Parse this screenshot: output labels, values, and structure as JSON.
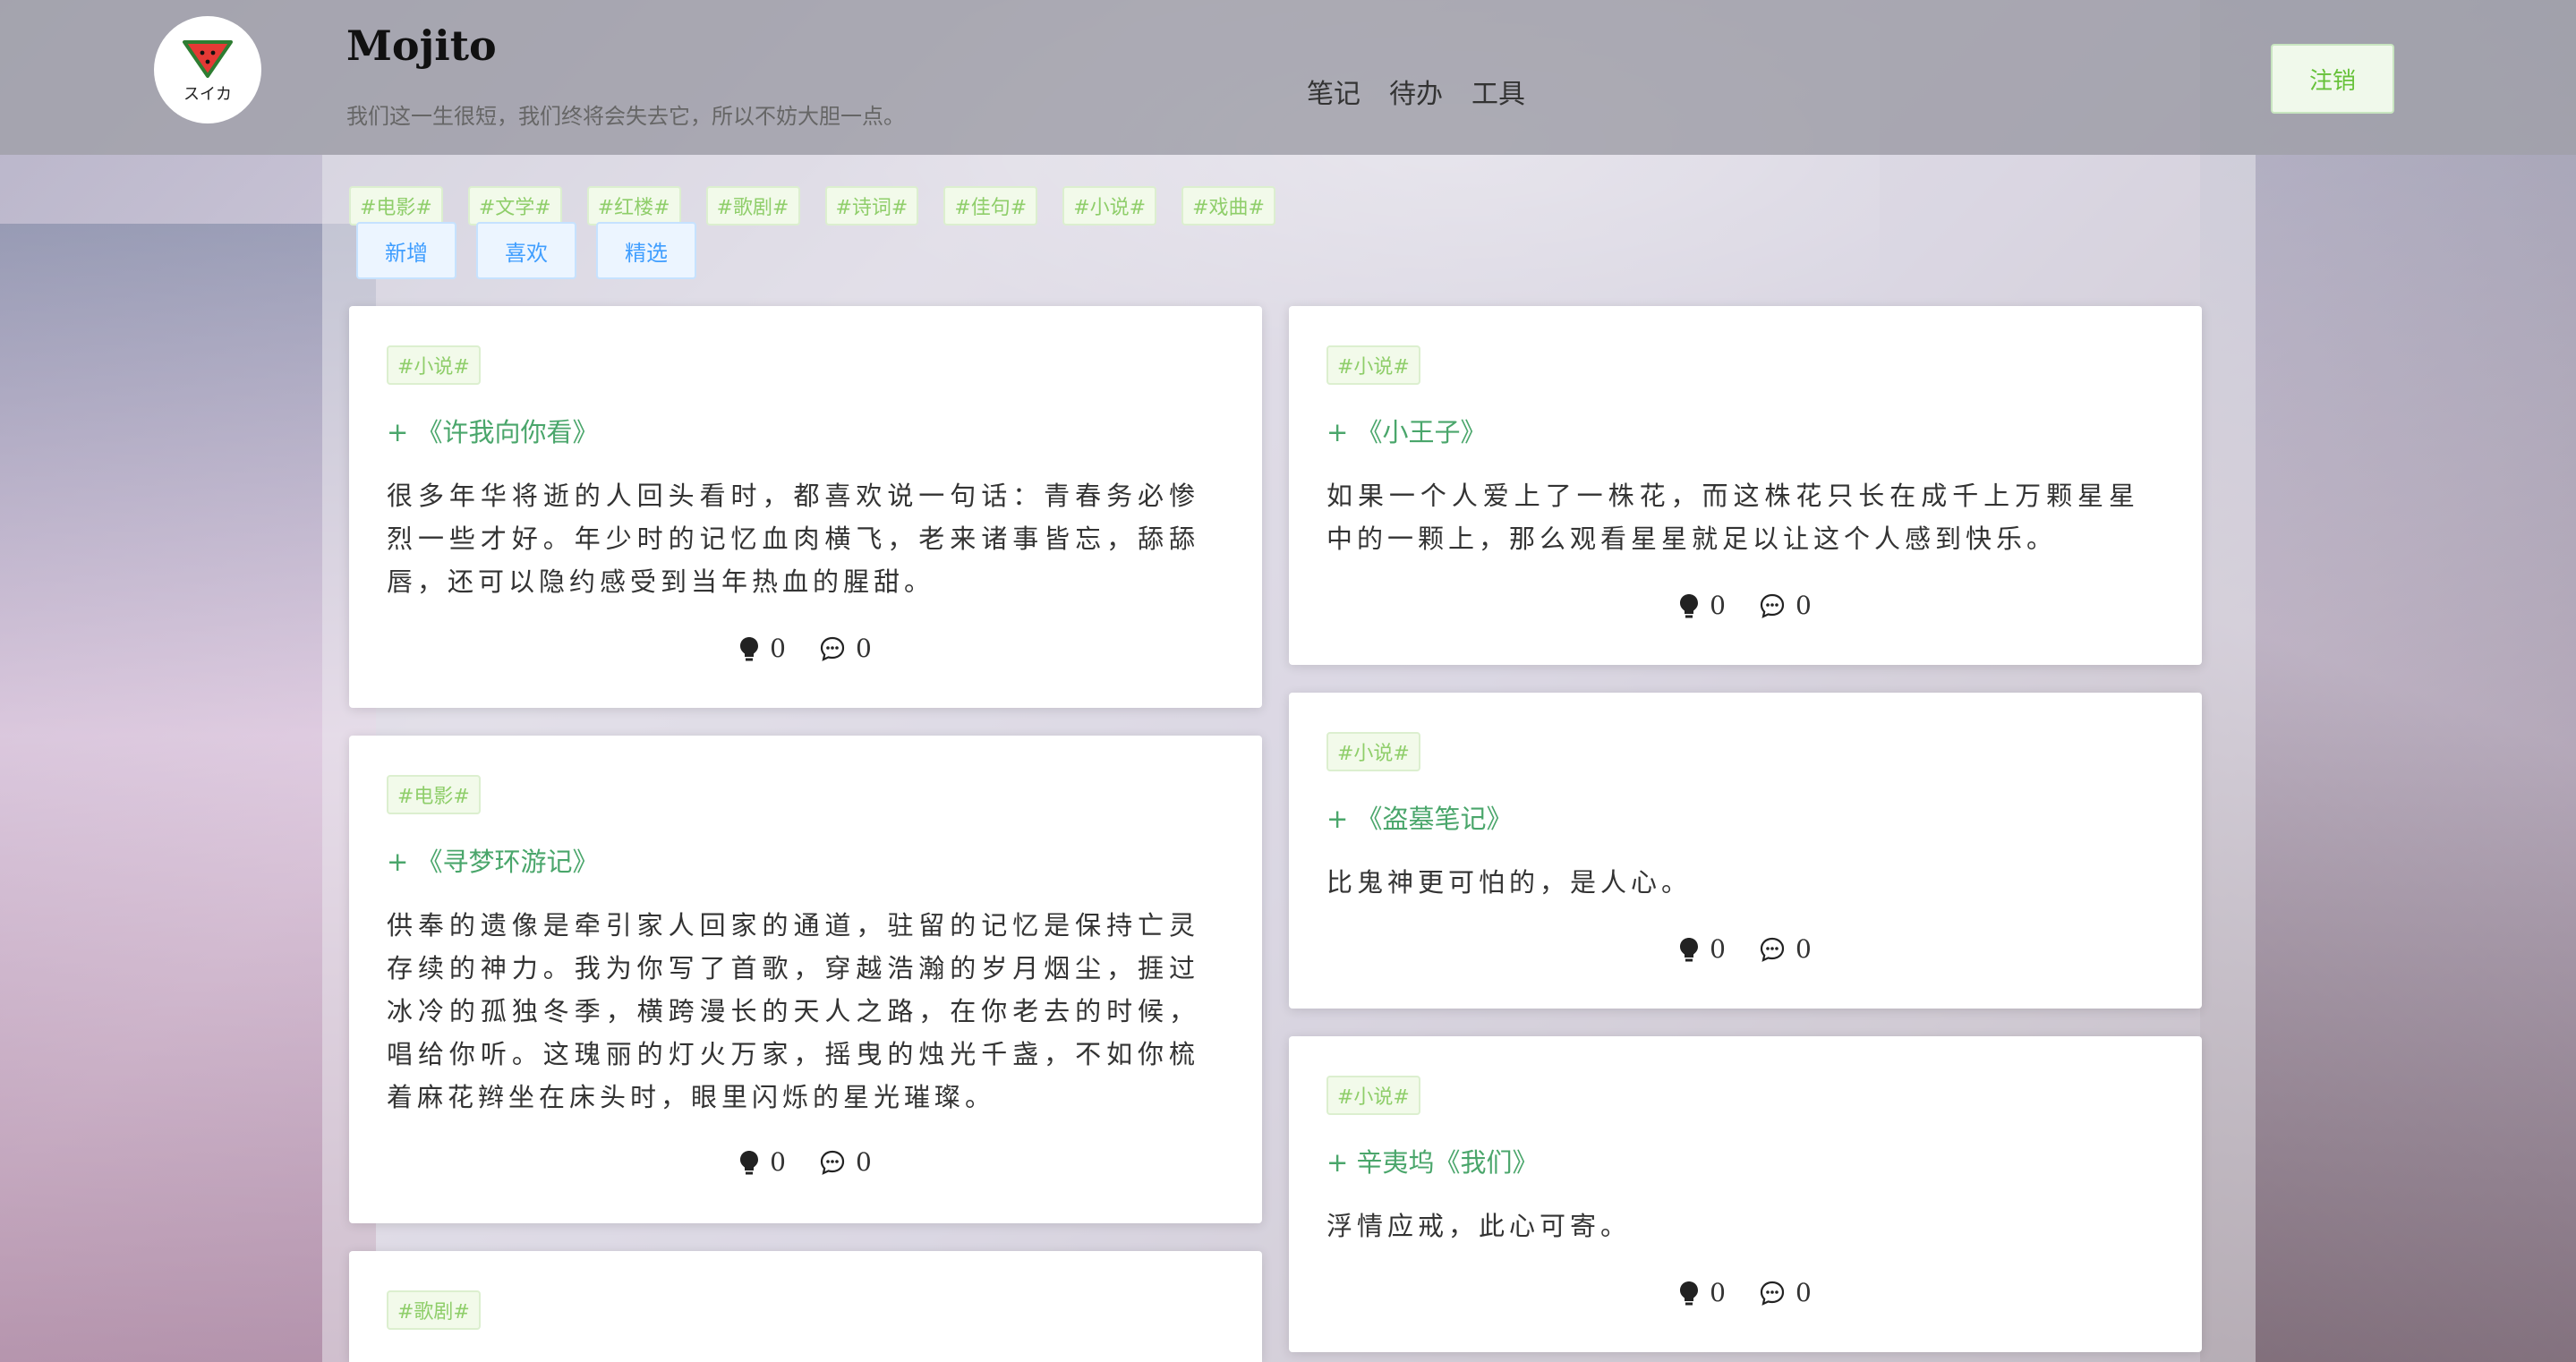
{
  "header": {
    "logo_text": "スイカ",
    "title": "Mojito",
    "motto": "我们这一生很短，我们终将会失去它，所以不妨大胆一点。",
    "nav": [
      "笔记",
      "待办",
      "工具"
    ],
    "logout_label": "注销"
  },
  "tags": [
    "#电影#",
    "#文学#",
    "#红楼#",
    "#歌剧#",
    "#诗词#",
    "#佳句#",
    "#小说#",
    "#戏曲#"
  ],
  "actions": [
    "新增",
    "喜欢",
    "精选"
  ],
  "cards": [
    {
      "tag": "#小说#",
      "title": "+ 《许我向你看》",
      "content": "很多年华将逝的人回头看时，都喜欢说一句话：青春务必惨烈一些才好。年少时的记忆血肉横飞，老来诸事皆忘，舔舔唇，还可以隐约感受到当年热血的腥甜。",
      "likes": "0",
      "comments": "0"
    },
    {
      "tag": "#电影#",
      "title": "+ 《寻梦环游记》",
      "content": "供奉的遗像是牵引家人回家的通道，驻留的记忆是保持亡灵存续的神力。我为你写了首歌，穿越浩瀚的岁月烟尘，捱过冰冷的孤独冬季，横跨漫长的天人之路，在你老去的时候，唱给你听。这瑰丽的灯火万家，摇曳的烛光千盏，不如你梳着麻花辫坐在床头时，眼里闪烁的星光璀璨。",
      "likes": "0",
      "comments": "0"
    },
    {
      "tag": "#歌剧#"
    },
    {
      "tag": "#小说#",
      "title": "+ 《小王子》",
      "content": "如果一个人爱上了一株花，而这株花只长在成千上万颗星星中的一颗上，那么观看星星就足以让这个人感到快乐。",
      "likes": "0",
      "comments": "0"
    },
    {
      "tag": "#小说#",
      "title": "+ 《盗墓笔记》",
      "content": "比鬼神更可怕的，是人心。",
      "likes": "0",
      "comments": "0"
    },
    {
      "tag": "#小说#",
      "title": "+ 辛夷坞《我们》",
      "content": "浮情应戒，此心可寄。",
      "likes": "0",
      "comments": "0"
    }
  ],
  "icons": {
    "like": "bulb-icon",
    "comment": "comment-icon"
  },
  "colors": {
    "title_green": "#4aa66b",
    "tag_green": "#8fce6a",
    "button_blue": "#409eff"
  }
}
